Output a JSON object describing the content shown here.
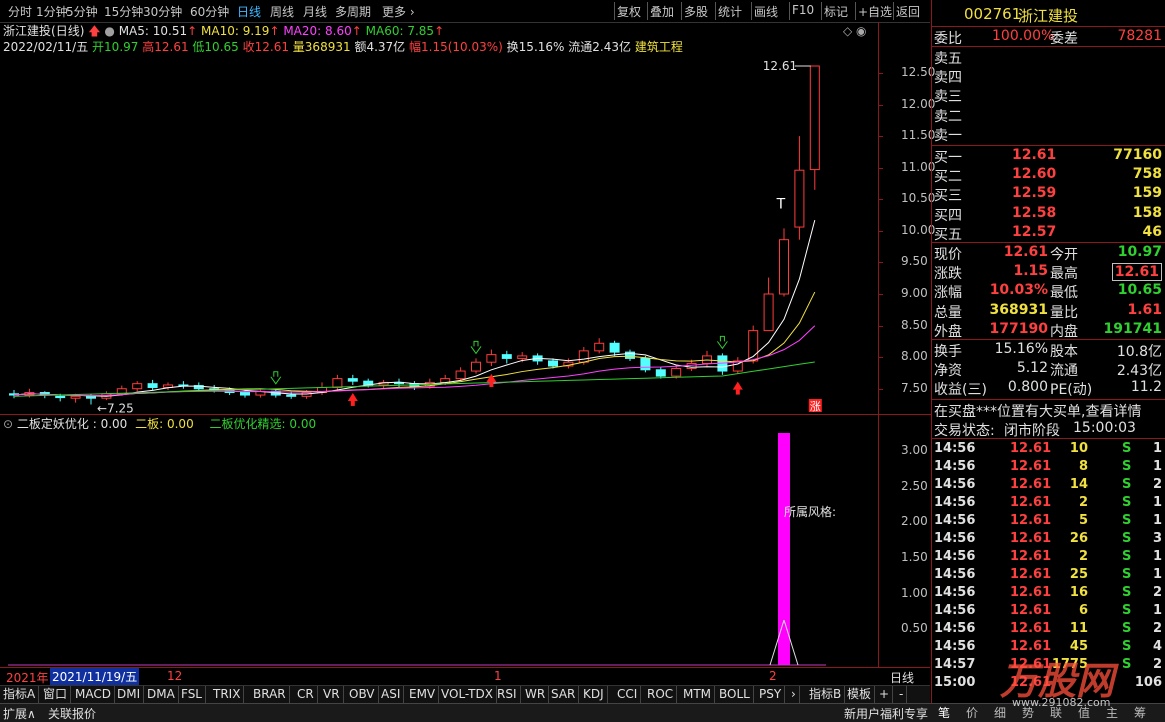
{
  "toolbar": {
    "left_items": [
      "分时",
      "1分钟",
      "5分钟",
      "15分钟",
      "30分钟",
      "60分钟",
      "日线",
      "周线",
      "月线",
      "多周期",
      "更多 ›"
    ],
    "active": "日线",
    "right_items": [
      "复权",
      "叠加",
      "多股",
      "统计",
      "画线",
      "F10",
      "标记",
      "+自选",
      "返回"
    ]
  },
  "info": {
    "name": "浙江建投",
    "period": "(日线)",
    "ma5": "MA5: 10.51",
    "ma10": "MA10: 9.19",
    "ma20": "MA20: 8.60",
    "ma60": "MA60: 7.85",
    "date": "2022/02/11/五",
    "open": "开10.97",
    "high": "高12.61",
    "low": "低10.65",
    "close": "收12.61",
    "vol": "量368931",
    "amount": "额4.37亿",
    "range": "幅1.15(10.03%)",
    "turnover": "换15.16%",
    "float": "流通2.43亿",
    "industry": "建筑工程"
  },
  "chart_labels": {
    "max_price": "12.61",
    "min_price": "7.25",
    "limit_mark": "涨",
    "t_mark": "T"
  },
  "price_axis": [
    "12.50",
    "12.00",
    "11.50",
    "11.00",
    "10.50",
    "10.00",
    "9.50",
    "9.00",
    "8.50",
    "8.00",
    "7.50"
  ],
  "indicator": {
    "title": "二板定妖优化 : 0.00",
    "item1": "二板: 0.00",
    "item2": "二板优化精选: 0.00",
    "annotation": "所属风格:",
    "axis": [
      "3.00",
      "2.50",
      "2.00",
      "1.50",
      "1.00",
      "0.50"
    ]
  },
  "timeaxis": {
    "year": "2021年",
    "date": "2021/11/19/五",
    "m12": "12",
    "m1": "1",
    "m2": "2",
    "period": "日线"
  },
  "indicator_tabs": [
    "指标A",
    "窗口",
    "MACD",
    "DMI",
    "DMA",
    "FSL",
    "TRIX",
    "BRAR",
    "CR",
    "VR",
    "OBV",
    "ASI",
    "EMV",
    "VOL-TDX",
    "RSI",
    "WR",
    "SAR",
    "KDJ",
    "CCI",
    "ROC",
    "MTM",
    "BOLL",
    "PSY",
    "›",
    "指标B",
    "模板",
    "+",
    "-"
  ],
  "bottom": {
    "expand": "扩展∧",
    "related": "关联报价",
    "promo": "新用户福利专享"
  },
  "quote": {
    "code": "002761",
    "name": "浙江建投",
    "weibi_label": "委比",
    "weibi": "100.00%",
    "weicha_label": "委差",
    "weicha": "78281",
    "asks": [
      {
        "label": "卖五",
        "price": "",
        "vol": ""
      },
      {
        "label": "卖四",
        "price": "",
        "vol": ""
      },
      {
        "label": "卖三",
        "price": "",
        "vol": ""
      },
      {
        "label": "卖二",
        "price": "",
        "vol": ""
      },
      {
        "label": "卖一",
        "price": "",
        "vol": ""
      }
    ],
    "bids": [
      {
        "label": "买一",
        "price": "12.61",
        "vol": "77160"
      },
      {
        "label": "买二",
        "price": "12.60",
        "vol": "758"
      },
      {
        "label": "买三",
        "price": "12.59",
        "vol": "159"
      },
      {
        "label": "买四",
        "price": "12.58",
        "vol": "158"
      },
      {
        "label": "买五",
        "price": "12.57",
        "vol": "46"
      }
    ],
    "stats": [
      {
        "l1": "现价",
        "v1": "12.61",
        "l2": "今开",
        "v2": "10.97"
      },
      {
        "l1": "涨跌",
        "v1": "1.15",
        "l2": "最高",
        "v2": "12.61"
      },
      {
        "l1": "涨幅",
        "v1": "10.03%",
        "l2": "最低",
        "v2": "10.65"
      },
      {
        "l1": "总量",
        "v1": "368931",
        "l2": "量比",
        "v2": "1.61"
      },
      {
        "l1": "外盘",
        "v1": "177190",
        "l2": "内盘",
        "v2": "191741"
      }
    ],
    "stats2": [
      {
        "l1": "换手",
        "v1": "15.16%",
        "l2": "股本",
        "v2": "10.8亿"
      },
      {
        "l1": "净资",
        "v1": "5.12",
        "l2": "流通",
        "v2": "2.43亿"
      },
      {
        "l1": "收益(三)",
        "v1": "0.800",
        "l2": "PE(动)",
        "v2": "11.2"
      }
    ],
    "notice": "在买盘***位置有大买单,查看详情",
    "status_label": "交易状态:",
    "status": "闭市阶段",
    "status_time": "15:00:03",
    "ticks": [
      {
        "t": "14:56",
        "p": "12.61",
        "v": "10",
        "s": "S",
        "n": "1"
      },
      {
        "t": "14:56",
        "p": "12.61",
        "v": "8",
        "s": "S",
        "n": "1"
      },
      {
        "t": "14:56",
        "p": "12.61",
        "v": "14",
        "s": "S",
        "n": "2"
      },
      {
        "t": "14:56",
        "p": "12.61",
        "v": "2",
        "s": "S",
        "n": "1"
      },
      {
        "t": "14:56",
        "p": "12.61",
        "v": "5",
        "s": "S",
        "n": "1"
      },
      {
        "t": "14:56",
        "p": "12.61",
        "v": "26",
        "s": "S",
        "n": "3"
      },
      {
        "t": "14:56",
        "p": "12.61",
        "v": "2",
        "s": "S",
        "n": "1"
      },
      {
        "t": "14:56",
        "p": "12.61",
        "v": "25",
        "s": "S",
        "n": "1"
      },
      {
        "t": "14:56",
        "p": "12.61",
        "v": "16",
        "s": "S",
        "n": "2"
      },
      {
        "t": "14:56",
        "p": "12.61",
        "v": "6",
        "s": "S",
        "n": "1"
      },
      {
        "t": "14:56",
        "p": "12.61",
        "v": "11",
        "s": "S",
        "n": "2"
      },
      {
        "t": "14:56",
        "p": "12.61",
        "v": "45",
        "s": "S",
        "n": "4"
      },
      {
        "t": "14:57",
        "p": "12.61",
        "v": "1775",
        "s": "S",
        "n": "2"
      },
      {
        "t": "15:00",
        "p": "12.61",
        "v": "",
        "s": "",
        "n": "106"
      }
    ],
    "side_tabs": [
      "笔",
      "价",
      "细",
      "势",
      "联",
      "值",
      "主",
      "筹"
    ]
  },
  "watermark": "万股网",
  "watermark_url": "www.291082.com",
  "candles": {
    "x_labels": [],
    "data": [
      [
        7.42,
        7.4,
        7.48,
        7.35
      ],
      [
        7.4,
        7.44,
        7.5,
        7.36
      ],
      [
        7.44,
        7.4,
        7.46,
        7.35
      ],
      [
        7.38,
        7.36,
        7.42,
        7.3
      ],
      [
        7.35,
        7.38,
        7.42,
        7.28
      ],
      [
        7.38,
        7.35,
        7.42,
        7.25
      ],
      [
        7.35,
        7.42,
        7.46,
        7.32
      ],
      [
        7.42,
        7.5,
        7.55,
        7.4
      ],
      [
        7.5,
        7.58,
        7.62,
        7.46
      ],
      [
        7.58,
        7.52,
        7.64,
        7.48
      ],
      [
        7.52,
        7.56,
        7.6,
        7.48
      ],
      [
        7.56,
        7.55,
        7.62,
        7.5
      ],
      [
        7.55,
        7.5,
        7.6,
        7.46
      ],
      [
        7.5,
        7.48,
        7.56,
        7.44
      ],
      [
        7.48,
        7.44,
        7.52,
        7.4
      ],
      [
        7.44,
        7.4,
        7.48,
        7.36
      ],
      [
        7.4,
        7.46,
        7.5,
        7.36
      ],
      [
        7.46,
        7.4,
        7.5,
        7.36
      ],
      [
        7.4,
        7.38,
        7.46,
        7.34
      ],
      [
        7.38,
        7.44,
        7.48,
        7.34
      ],
      [
        7.44,
        7.52,
        7.6,
        7.4
      ],
      [
        7.52,
        7.66,
        7.72,
        7.48
      ],
      [
        7.66,
        7.62,
        7.72,
        7.56
      ],
      [
        7.62,
        7.56,
        7.66,
        7.52
      ],
      [
        7.56,
        7.6,
        7.64,
        7.5
      ],
      [
        7.6,
        7.58,
        7.66,
        7.52
      ],
      [
        7.58,
        7.54,
        7.62,
        7.48
      ],
      [
        7.54,
        7.6,
        7.66,
        7.5
      ],
      [
        7.6,
        7.66,
        7.72,
        7.56
      ],
      [
        7.66,
        7.78,
        7.84,
        7.62
      ],
      [
        7.78,
        7.92,
        7.98,
        7.74
      ],
      [
        7.92,
        8.04,
        8.12,
        7.86
      ],
      [
        8.04,
        7.98,
        8.1,
        7.9
      ],
      [
        7.98,
        8.02,
        8.08,
        7.92
      ],
      [
        8.02,
        7.94,
        8.06,
        7.88
      ],
      [
        7.94,
        7.86,
        7.98,
        7.82
      ],
      [
        7.86,
        7.92,
        7.98,
        7.82
      ],
      [
        7.92,
        8.1,
        8.16,
        7.88
      ],
      [
        8.1,
        8.22,
        8.3,
        8.06
      ],
      [
        8.22,
        8.08,
        8.26,
        8.02
      ],
      [
        8.08,
        7.98,
        8.12,
        7.94
      ],
      [
        7.98,
        7.8,
        8.02,
        7.76
      ],
      [
        7.8,
        7.7,
        7.84,
        7.66
      ],
      [
        7.7,
        7.82,
        7.88,
        7.66
      ],
      [
        7.82,
        7.9,
        7.96,
        7.78
      ],
      [
        7.9,
        8.02,
        8.1,
        7.84
      ],
      [
        8.02,
        7.78,
        8.06,
        7.72
      ],
      [
        7.78,
        7.94,
        8.0,
        7.74
      ],
      [
        7.94,
        8.42,
        8.5,
        7.9
      ],
      [
        8.42,
        9.0,
        9.26,
        8.9
      ],
      [
        9.0,
        9.86,
        10.04,
        8.96
      ],
      [
        10.06,
        10.96,
        11.5,
        9.86
      ],
      [
        10.97,
        12.61,
        12.61,
        10.65
      ]
    ]
  }
}
